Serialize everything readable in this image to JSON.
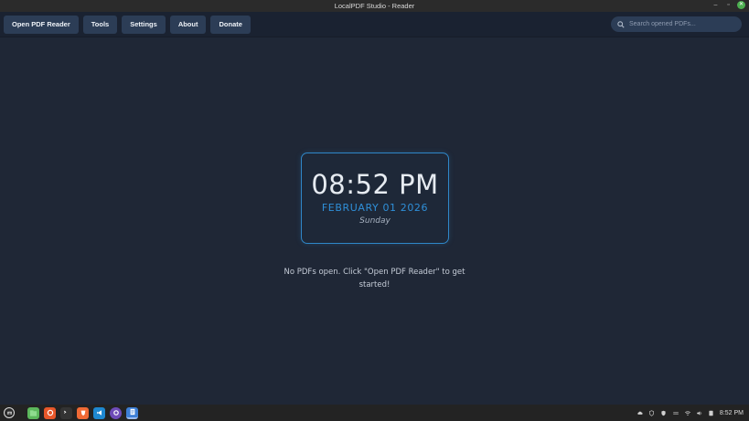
{
  "window": {
    "title": "LocalPDF Studio - Reader",
    "minimize_glyph": "–",
    "maximize_glyph": "▫",
    "close_glyph": "✕"
  },
  "toolbar": {
    "buttons": [
      "Open PDF Reader",
      "Tools",
      "Settings",
      "About",
      "Donate"
    ],
    "search_placeholder": "Search opened PDFs..."
  },
  "clock": {
    "time": "08:52 PM",
    "date": "FEBRUARY 01 2026",
    "day": "Sunday"
  },
  "main": {
    "empty_message": "No PDFs open. Click \"Open PDF Reader\" to get started!"
  },
  "taskbar": {
    "apps": [
      {
        "name": "menu-icon",
        "color": "#2b2b2b"
      },
      {
        "name": "files-icon",
        "color": "#5cb85c"
      },
      {
        "name": "software-manager-icon",
        "color": "#e8572a"
      },
      {
        "name": "terminal-icon",
        "color": "#333333"
      },
      {
        "name": "brave-icon",
        "color": "#f06a35"
      },
      {
        "name": "vscode-icon",
        "color": "#1e88d0"
      },
      {
        "name": "github-icon",
        "color": "#6e4bb8"
      },
      {
        "name": "document-viewer-icon",
        "color": "#3d7fd6"
      }
    ],
    "clock": "8:52 PM"
  },
  "colors": {
    "background": "#1f2736",
    "toolbar": "#1a2231",
    "button": "#2c3d56",
    "accent": "#2f8fd8"
  }
}
